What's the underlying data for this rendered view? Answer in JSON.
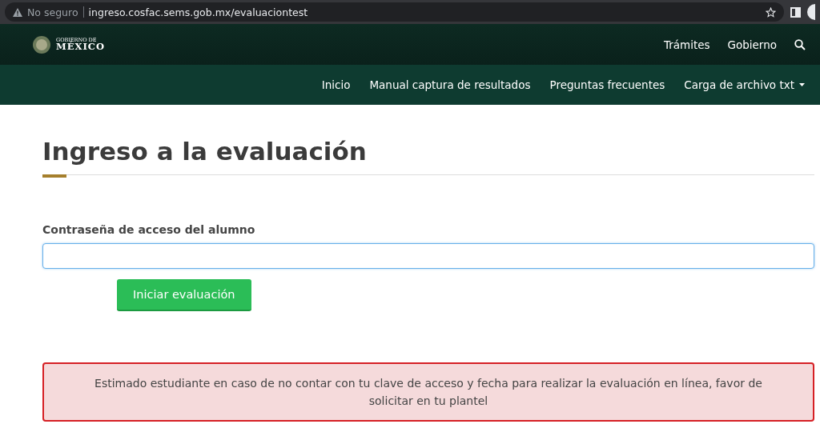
{
  "browser": {
    "security": "No seguro",
    "url": "ingreso.cosfac.sems.gob.mx/evaluaciontest"
  },
  "header": {
    "logo_top": "GOBIERNO DE",
    "logo_bottom": "MÉXICO",
    "links": [
      "Trámites",
      "Gobierno"
    ]
  },
  "nav": {
    "items": [
      {
        "label": "Inicio",
        "dropdown": false
      },
      {
        "label": "Manual captura de resultados",
        "dropdown": false
      },
      {
        "label": "Preguntas frecuentes",
        "dropdown": false
      },
      {
        "label": "Carga de archivo txt",
        "dropdown": true
      }
    ]
  },
  "page": {
    "title": "Ingreso a la evaluación",
    "field_label": "Contraseña de acceso del alumno",
    "field_focused": true,
    "button": "Iniciar evaluación",
    "alert": "Estimado estudiante en caso de no contar con tu clave de acceso y fecha para realizar la evaluación en línea, favor de solicitar en tu plantel"
  }
}
